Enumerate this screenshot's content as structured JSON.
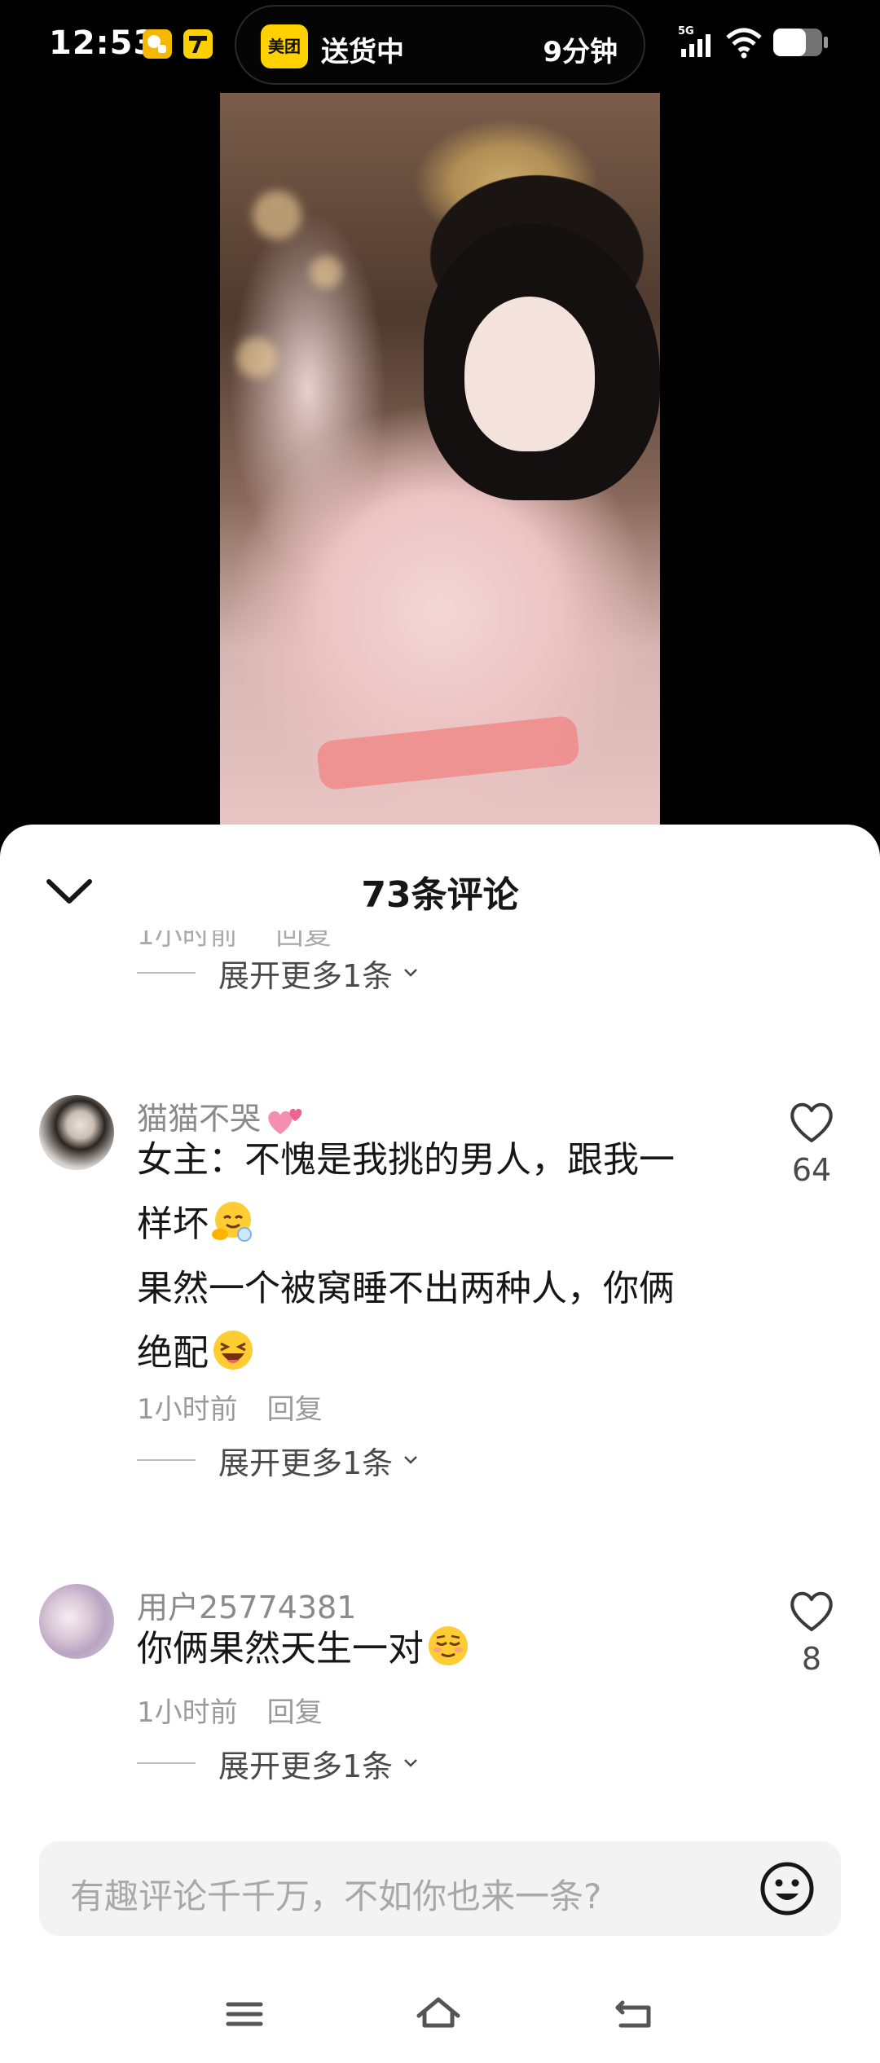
{
  "status_bar": {
    "time": "12:53",
    "notification_icons": [
      "meituan-notify-icon",
      "meituan-7-icon"
    ],
    "live_activity": {
      "app": "美团",
      "status": "送货中",
      "eta": "9分钟"
    },
    "network": "5G",
    "icons": [
      "signal-icon",
      "wifi-icon",
      "battery-icon"
    ]
  },
  "sheet": {
    "title": "73条评论"
  },
  "partial_comment_meta": {
    "time": "1小时前",
    "reply": "回复"
  },
  "expand_label": "展开更多1条",
  "comments": [
    {
      "username": "猫猫不哭",
      "lines": [
        "女主：不愧是我挑的男人，跟我一",
        "样坏",
        "果然一个被窝睡不出两种人，你俩",
        "绝配"
      ],
      "time": "1小时前",
      "reply": "回复",
      "likes": "64",
      "expand": "展开更多1条"
    },
    {
      "username": "用户25774381",
      "lines": [
        "你俩果然天生一对"
      ],
      "time": "1小时前",
      "reply": "回复",
      "likes": "8",
      "expand": "展开更多1条"
    }
  ],
  "input": {
    "placeholder": "有趣评论千千万，不如你也来一条?"
  },
  "colors": {
    "accent_yellow": "#ffd100",
    "text_primary": "#161616",
    "text_secondary": "#9a9a9a",
    "input_bg": "#f3f3f3"
  }
}
